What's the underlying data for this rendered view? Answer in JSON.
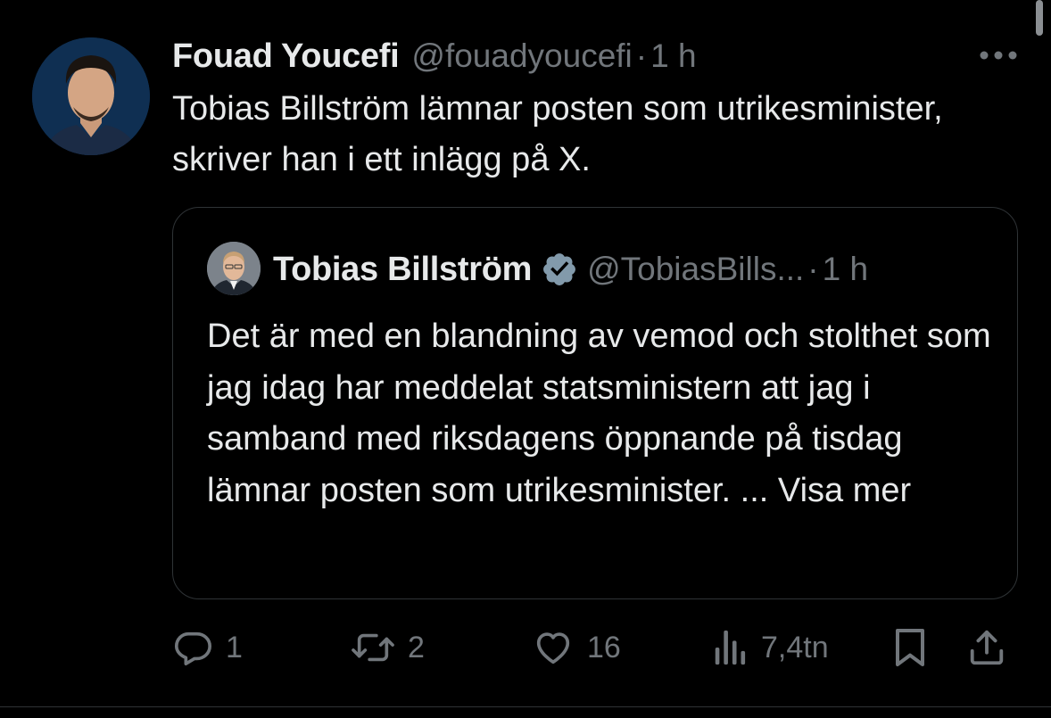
{
  "post": {
    "author": {
      "display_name": "Fouad Youcefi",
      "handle": "@fouadyoucefi"
    },
    "separator": "·",
    "time": "1 h",
    "text": "Tobias Billström lämnar posten som utrikesminister, skriver han i ett inlägg på X.",
    "more_icon": "more-horizontal-icon"
  },
  "quote": {
    "author": {
      "display_name": "Tobias Billström",
      "handle": "@TobiasBills...",
      "verified": true
    },
    "separator": "·",
    "time": "1 h",
    "text": "Det är med en blandning av vemod och stolthet som jag idag har meddelat statsministern att jag i samband med riksdagens öppnande på tisdag lämnar posten som utrikesminister. ...",
    "show_more": "Visa mer"
  },
  "actions": {
    "reply_count": "1",
    "repost_count": "2",
    "like_count": "16",
    "view_count": "7,4tn"
  },
  "colors": {
    "background": "#000000",
    "text_primary": "#e7e9ea",
    "text_secondary": "#71767b",
    "border": "#2f3336",
    "verified": "#829aab"
  }
}
